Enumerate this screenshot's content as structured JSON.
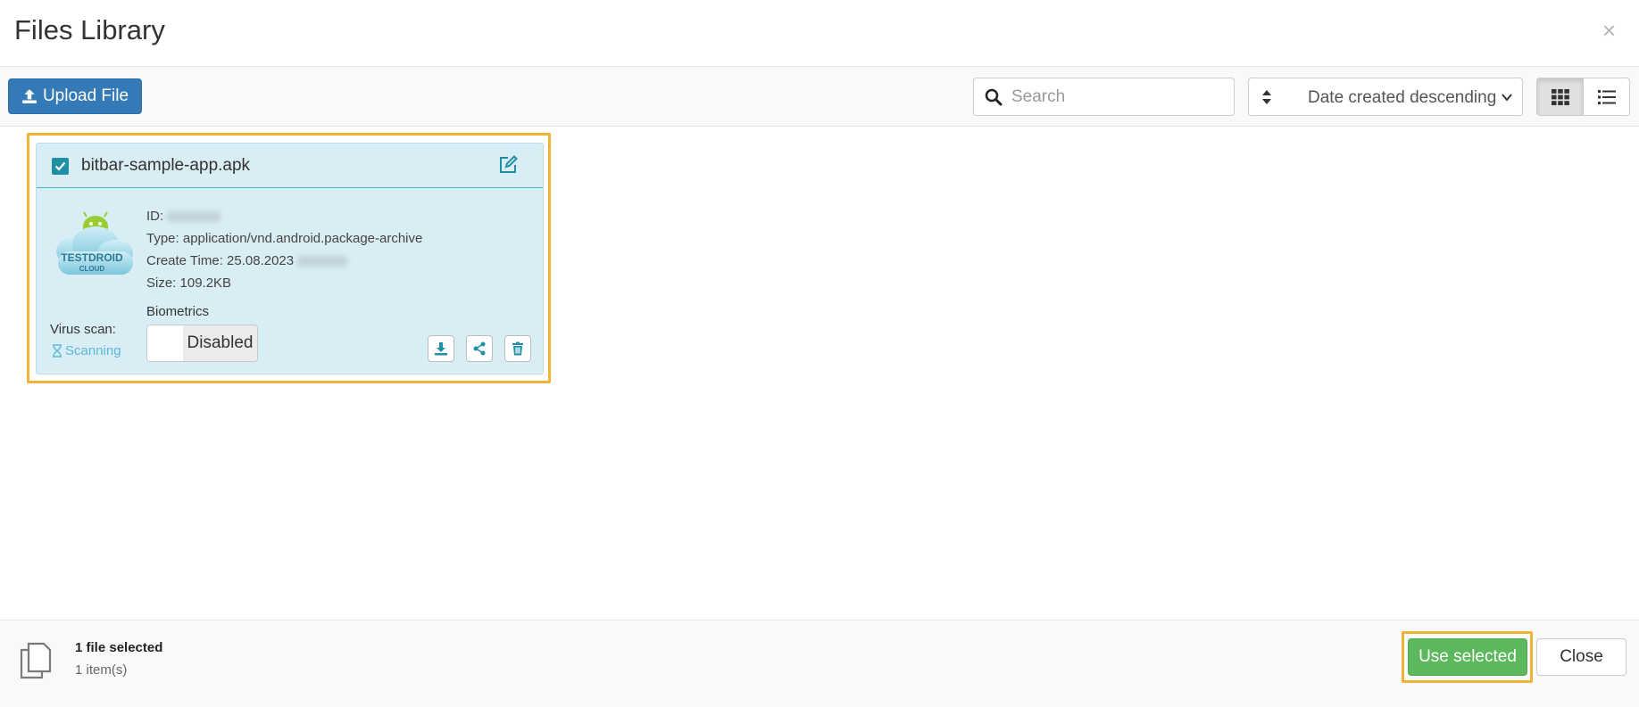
{
  "header": {
    "title": "Files Library",
    "close_glyph": "×"
  },
  "toolbar": {
    "upload_label": "Upload File",
    "search_placeholder": "Search",
    "search_value": "",
    "sort_selected": "Date created descending",
    "view_modes": [
      "grid",
      "list"
    ],
    "active_view": "grid"
  },
  "file": {
    "name": "bitbar-sample-app.apk",
    "selected": true,
    "id_label": "ID:",
    "type_label": "Type: application/vnd.android.package-archive",
    "create_label": "Create Time: 25.08.2023",
    "size_label": "Size: 109.2KB",
    "logo_text": "TESTDROID",
    "logo_subtext": "CLOUD",
    "virus_scan_label": "Virus scan:",
    "virus_scan_status": "Scanning",
    "biometrics_label": "Biometrics",
    "biometrics_state": "Disabled"
  },
  "footer": {
    "selected_count": "1 file selected",
    "item_count": "1 item(s)",
    "use_selected_label": "Use selected",
    "close_label": "Close"
  },
  "colors": {
    "primary": "#337ab7",
    "success": "#5cb85c",
    "card_bg": "#d9eef4",
    "accent_teal": "#1f8fa6",
    "highlight": "#f0b335"
  },
  "icons": {
    "upload": "upload-icon",
    "search": "search-icon",
    "sort": "sort-icon",
    "grid": "grid-view-icon",
    "list": "list-view-icon",
    "edit": "edit-icon",
    "download": "download-icon",
    "share": "share-icon",
    "delete": "trash-icon",
    "hourglass": "hourglass-icon",
    "files": "files-copy-icon"
  }
}
